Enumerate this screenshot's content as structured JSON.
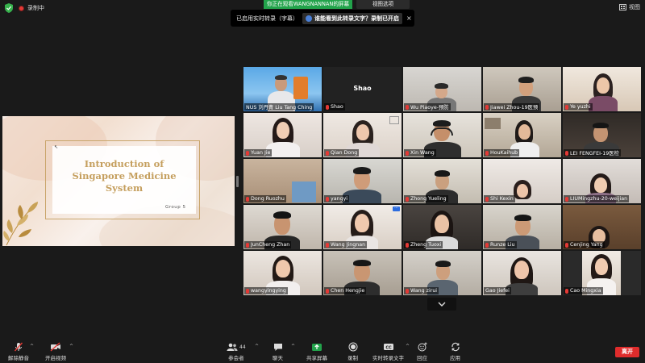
{
  "topbar": {
    "recording_label": "录制中",
    "sharing_banner": "你正在观看WANGNANNAN的屏幕",
    "view_options": "视图选项",
    "view_button": "视图"
  },
  "captions": {
    "enabled_text": "已启用实时转录（字幕）",
    "ask_text": "谁能看到此转录文字？录制已开启",
    "close": "×"
  },
  "slide": {
    "title_line1": "Introduction of",
    "title_line2": "Singapore Medicine System",
    "subtitle": "Group 5"
  },
  "participants": [
    {
      "name": "NUS 刘丹青 Liu Tang Ching",
      "muted": false
    },
    {
      "name": "Shao",
      "muted": true,
      "display": "Shao"
    },
    {
      "name": "Wu Piaoye-预防",
      "muted": true
    },
    {
      "name": "Jiawei Zhou-19医预",
      "muted": true
    },
    {
      "name": "Ye yuzhi",
      "muted": true
    },
    {
      "name": "Yuan Jie",
      "muted": true
    },
    {
      "name": "Qian Dong",
      "muted": true
    },
    {
      "name": "Xin Wang",
      "muted": true
    },
    {
      "name": "HouKaihub",
      "muted": true
    },
    {
      "name": "LEI FENGFEI-19医检",
      "muted": true
    },
    {
      "name": "Dong Ruozhu",
      "muted": true
    },
    {
      "name": "yangyi",
      "muted": true
    },
    {
      "name": "Zhong Yueling",
      "muted": true
    },
    {
      "name": "Shi Kexin",
      "muted": true
    },
    {
      "name": "LIUMingzhu-20-weijian",
      "muted": true
    },
    {
      "name": "JunCheng Zhan",
      "muted": true
    },
    {
      "name": "Wang Jingnan",
      "muted": true
    },
    {
      "name": "Zheng Tuoxi",
      "muted": true
    },
    {
      "name": "Runze Liu",
      "muted": true
    },
    {
      "name": "Cenjing Yang",
      "muted": true
    },
    {
      "name": "wangyingying",
      "muted": true
    },
    {
      "name": "Chen Hengjie",
      "muted": true
    },
    {
      "name": "Wang zirui",
      "muted": true
    },
    {
      "name": "Gao Jiefei",
      "muted": false
    },
    {
      "name": "Cao Mingxia",
      "muted": true
    }
  ],
  "toolbar": {
    "unmute": "解除静音",
    "start_video": "开启视频",
    "participants": "参会者",
    "participants_count": "44",
    "chat": "聊天",
    "share_screen": "共享屏幕",
    "record": "录制",
    "live_transcript": "实时转录文字",
    "reactions": "回应",
    "apps": "应用",
    "end": "离开"
  },
  "colors": {
    "share_green": "#22a34b",
    "active_speaker": "#a6d13a",
    "end_red": "#e02c2c",
    "muted_red": "#e53935"
  }
}
